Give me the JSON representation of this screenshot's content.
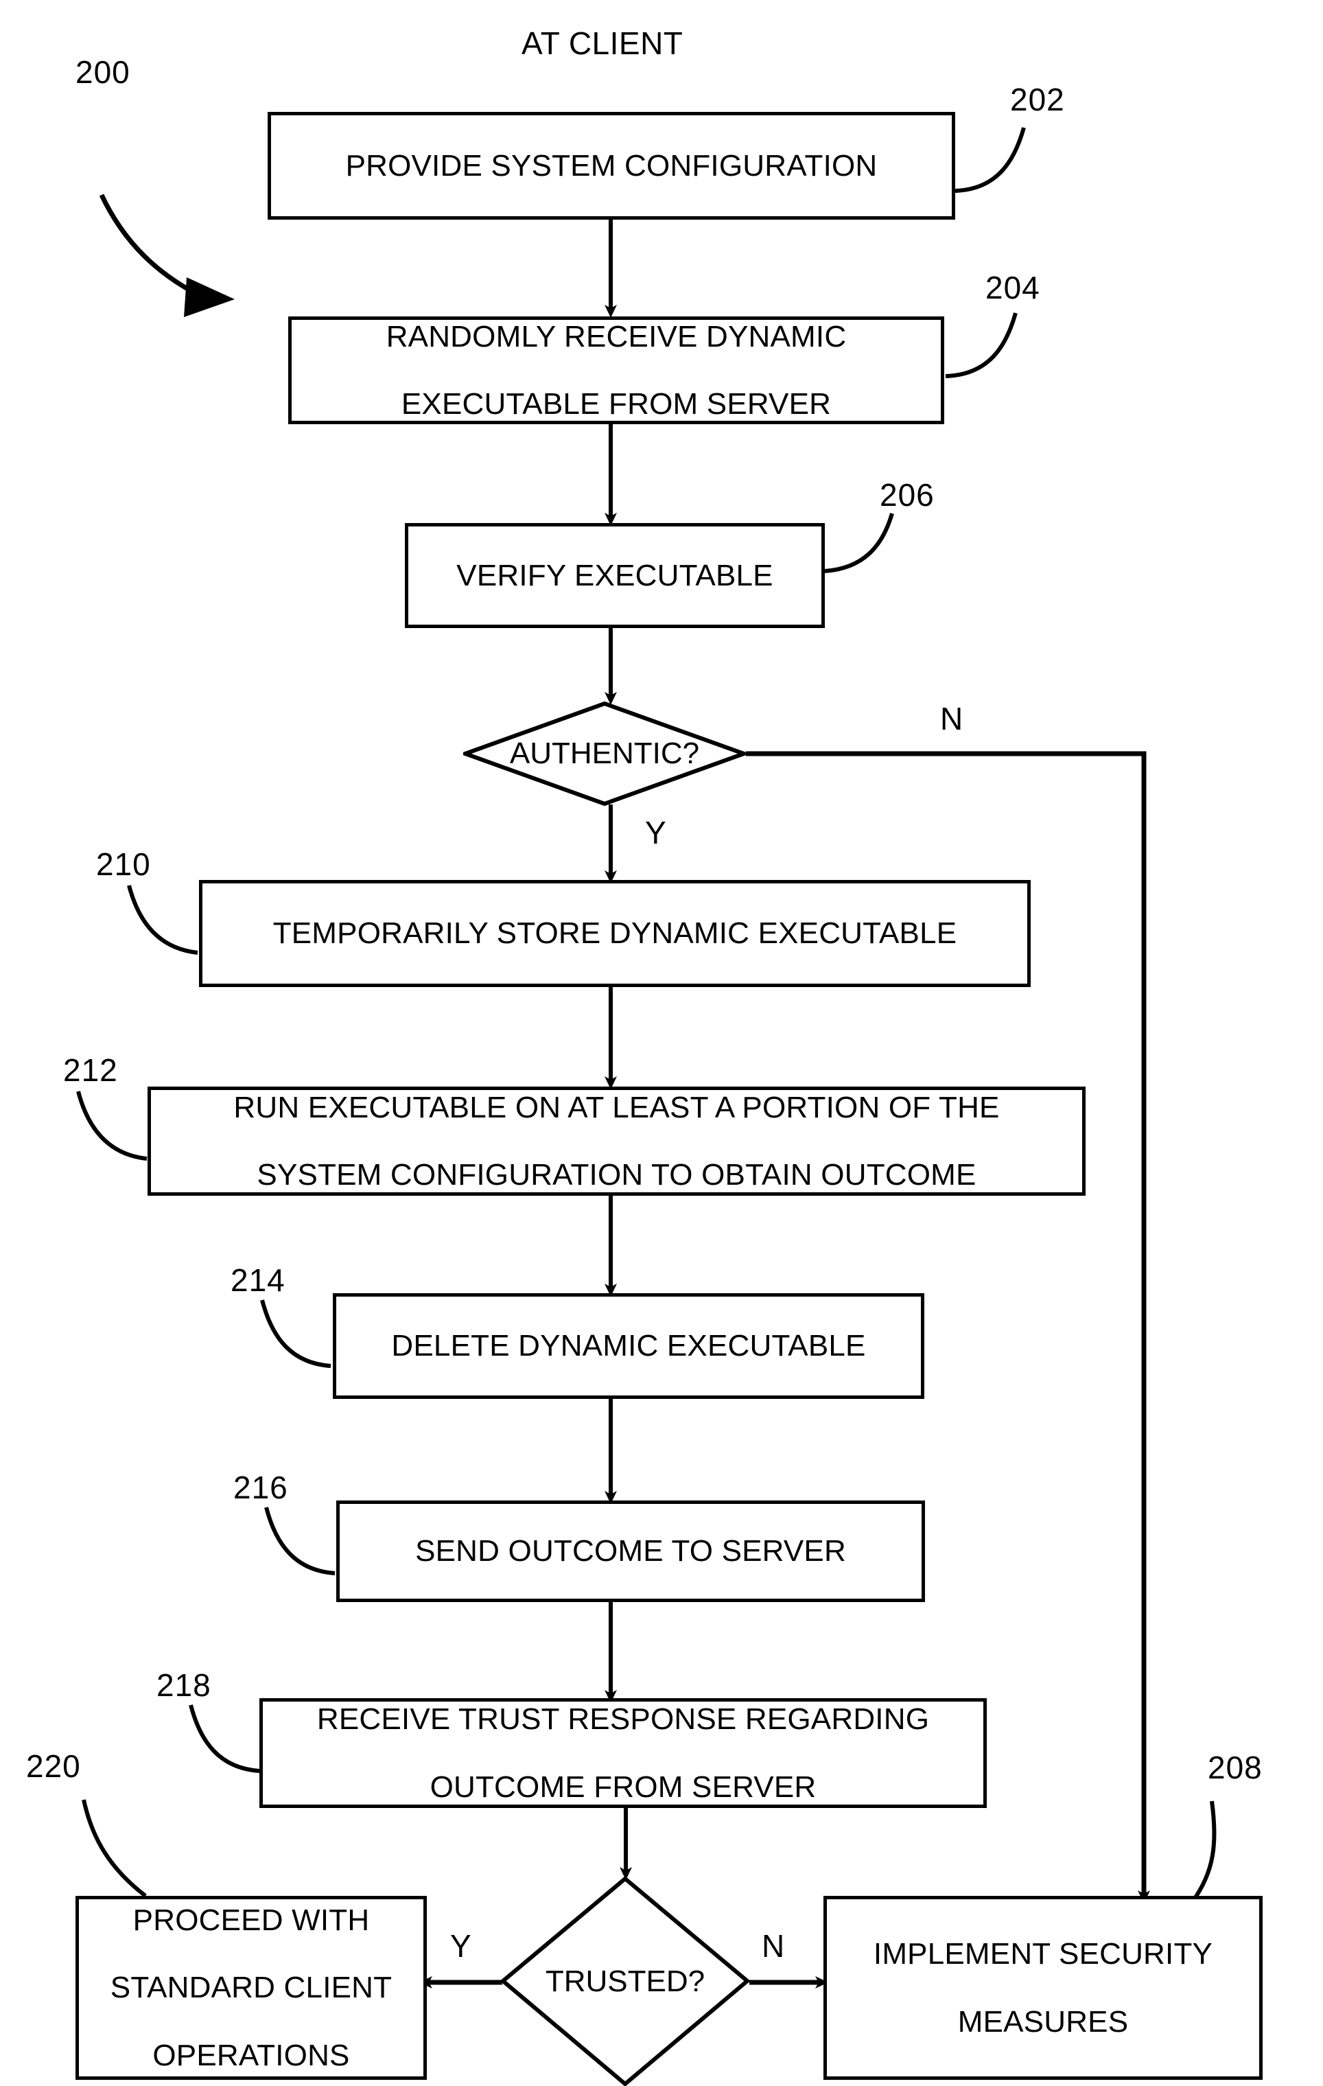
{
  "figure": {
    "title": "AT CLIENT",
    "figure_ref": "200",
    "style": {
      "stroke": "#000000",
      "background": "#ffffff"
    }
  },
  "nodes": [
    {
      "id": "n202",
      "ref": "202",
      "shape": "process",
      "text": "PROVIDE SYSTEM CONFIGURATION"
    },
    {
      "id": "n204",
      "ref": "204",
      "shape": "process",
      "line1": "RANDOMLY RECEIVE DYNAMIC",
      "line2": "EXECUTABLE FROM SERVER"
    },
    {
      "id": "n206",
      "ref": "206",
      "shape": "process",
      "text": "VERIFY EXECUTABLE"
    },
    {
      "id": "d208",
      "ref": "",
      "shape": "decision",
      "text": "AUTHENTIC?"
    },
    {
      "id": "n210",
      "ref": "210",
      "shape": "process",
      "text": "TEMPORARILY STORE DYNAMIC EXECUTABLE"
    },
    {
      "id": "n212",
      "ref": "212",
      "shape": "process",
      "line1": "RUN EXECUTABLE ON AT LEAST A PORTION OF THE",
      "line2": "SYSTEM CONFIGURATION TO OBTAIN OUTCOME"
    },
    {
      "id": "n214",
      "ref": "214",
      "shape": "process",
      "text": "DELETE DYNAMIC EXECUTABLE"
    },
    {
      "id": "n216",
      "ref": "216",
      "shape": "process",
      "text": "SEND OUTCOME TO SERVER"
    },
    {
      "id": "n218",
      "ref": "218",
      "shape": "process",
      "line1": "RECEIVE TRUST RESPONSE REGARDING",
      "line2": "OUTCOME FROM SERVER"
    },
    {
      "id": "d219",
      "ref": "",
      "shape": "decision",
      "text": "TRUSTED?"
    },
    {
      "id": "n220",
      "ref": "220",
      "shape": "process",
      "line1": "PROCEED WITH",
      "line2": "STANDARD CLIENT",
      "line3": "OPERATIONS"
    },
    {
      "id": "n208",
      "ref": "208",
      "shape": "process",
      "line1": "IMPLEMENT SECURITY",
      "line2": "MEASURES"
    }
  ],
  "labels": {
    "ref_200": "200",
    "ref_202": "202",
    "ref_204": "204",
    "ref_206": "206",
    "ref_208": "208",
    "ref_210": "210",
    "ref_212": "212",
    "ref_214": "214",
    "ref_216": "216",
    "ref_218": "218",
    "ref_220": "220"
  },
  "branches": {
    "authentic_no": "N",
    "authentic_yes": "Y",
    "trusted_yes": "Y",
    "trusted_no": "N"
  },
  "edges": [
    {
      "from": "n202",
      "to": "n204",
      "label": ""
    },
    {
      "from": "n204",
      "to": "n206",
      "label": ""
    },
    {
      "from": "n206",
      "to": "d208",
      "label": ""
    },
    {
      "from": "d208",
      "to": "n210",
      "label": "Y"
    },
    {
      "from": "d208",
      "to": "n208",
      "label": "N"
    },
    {
      "from": "n210",
      "to": "n212",
      "label": ""
    },
    {
      "from": "n212",
      "to": "n214",
      "label": ""
    },
    {
      "from": "n214",
      "to": "n216",
      "label": ""
    },
    {
      "from": "n216",
      "to": "n218",
      "label": ""
    },
    {
      "from": "n218",
      "to": "d219",
      "label": ""
    },
    {
      "from": "d219",
      "to": "n220",
      "label": "Y"
    },
    {
      "from": "d219",
      "to": "n208",
      "label": "N"
    }
  ]
}
